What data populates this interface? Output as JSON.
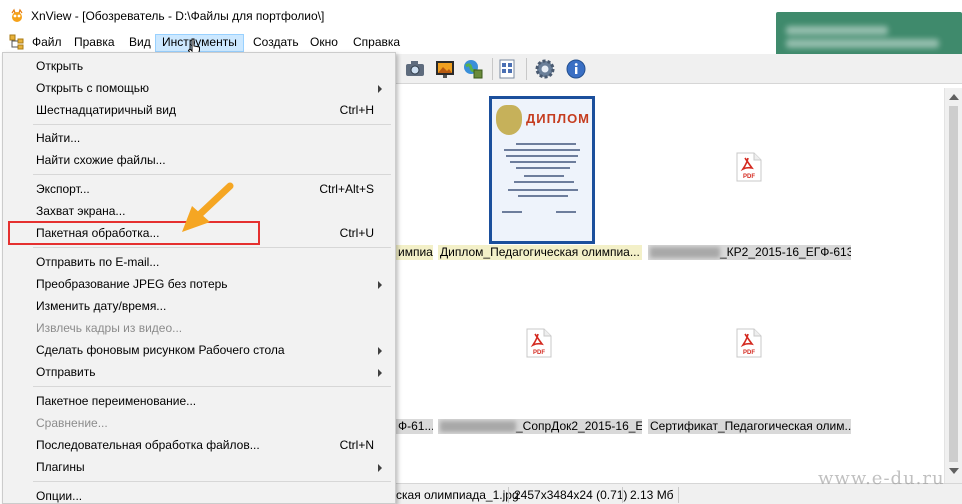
{
  "app": {
    "title": "XnView - [Обозреватель - D:\\Файлы для портфолио\\]"
  },
  "menubar": {
    "items": [
      "Файл",
      "Правка",
      "Вид",
      "Инструменты",
      "Создать",
      "Окно",
      "Справка"
    ],
    "active": "Инструменты"
  },
  "dropdown": {
    "items": [
      {
        "label": "Открыть",
        "shortcut": ""
      },
      {
        "label": "Открыть с помощью",
        "shortcut": ""
      },
      {
        "label": "Шестнадцатиричный вид",
        "shortcut": "Ctrl+H"
      },
      {
        "label": "Найти...",
        "shortcut": ""
      },
      {
        "label": "Найти схожие файлы...",
        "shortcut": ""
      },
      {
        "label": "Экспорт...",
        "shortcut": "Ctrl+Alt+S"
      },
      {
        "label": "Захват экрана...",
        "shortcut": ""
      },
      {
        "label": "Пакетная обработка...",
        "shortcut": "Ctrl+U"
      },
      {
        "label": "Отправить по E-mail...",
        "shortcut": ""
      },
      {
        "label": "Преобразование JPEG без потерь",
        "shortcut": ""
      },
      {
        "label": "Изменить дату/время...",
        "shortcut": ""
      },
      {
        "label": "Извлечь кадры из видео...",
        "shortcut": ""
      },
      {
        "label": "Сделать фоновым рисунком Рабочего стола",
        "shortcut": ""
      },
      {
        "label": "Отправить",
        "shortcut": ""
      },
      {
        "label": "Пакетное переименование...",
        "shortcut": ""
      },
      {
        "label": "Сравнение...",
        "shortcut": ""
      },
      {
        "label": "Последовательная обработка файлов...",
        "shortcut": "Ctrl+N"
      },
      {
        "label": "Плагины",
        "shortcut": ""
      },
      {
        "label": "Опции...",
        "shortcut": ""
      }
    ]
  },
  "thumbnails": {
    "diploma_title": "ДИПЛОМ",
    "pdf_label": "PDF",
    "captions": [
      "импиа...",
      "Диплом_Педагогическая олимпиа...",
      "_КР2_2015-16_ЕГФ-613...",
      "Ф-61...",
      "_СопрДок2_2015-16_Е...",
      "Сертификат_Педагогическая олим..."
    ]
  },
  "status": {
    "filename": "ская олимпиада_1.jpg",
    "dimensions": "2457x3484x24 (0.71)",
    "size": "2.13 Мб"
  },
  "watermark": "www.e-du.ru",
  "colors": {
    "menu_hover": "#cce8ff",
    "highlight": "#e5302f",
    "arrow": "#f5a623",
    "toast": "#3f8a6c",
    "diploma_border": "#1b4f9c"
  }
}
